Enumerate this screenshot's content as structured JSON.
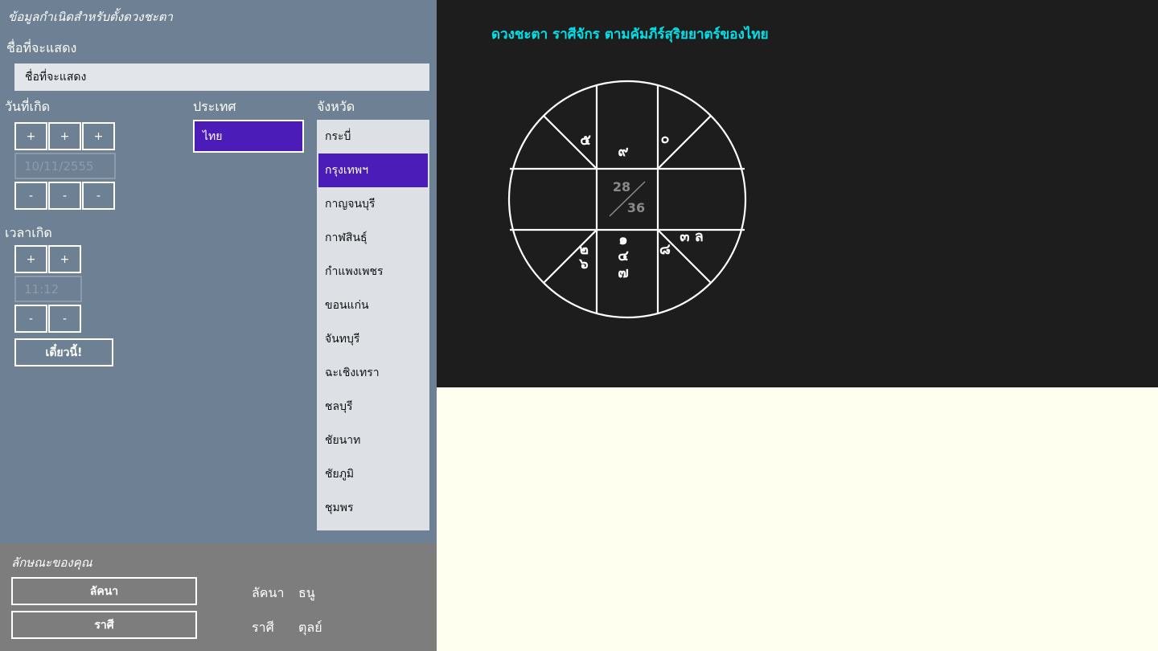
{
  "birth": {
    "header": "ข้อมูลกำเนิดสำหรับตั้งดวงชะตา",
    "name_label": "ชื่อที่จะแสดง",
    "name_value": "ชื่อที่จะแสดง",
    "date_label": "วันที่เกิด",
    "date_value": "10/11/2555",
    "plus": "+",
    "minus": "-",
    "time_label": "เวลาเกิด",
    "time_value": "11:12",
    "now_button": "เดี๋ยวนี้!",
    "country_label": "ประเทศ",
    "countries": [
      "ไทย"
    ],
    "province_label": "จังหวัด",
    "provinces": [
      "กระบี่",
      "กรุงเทพฯ",
      "กาญจนบุรี",
      "กาฬสินธุ์",
      "กำแพงเพชร",
      "ขอนแก่น",
      "จันทบุรี",
      "ฉะเชิงเทรา",
      "ชลบุรี",
      "ชัยนาท",
      "ชัยภูมิ",
      "ชุมพร"
    ],
    "selected_province": "กรุงเทพฯ"
  },
  "traits": {
    "header": "ลักษณะของคุณ",
    "lagna_button": "ลัคนา",
    "rasi_button": "ราศี",
    "lagna_label": "ลัคนา",
    "lagna_value": "ธนู",
    "rasi_label": "ราศี",
    "rasi_value": "ตุลย์"
  },
  "chart": {
    "title": "ดวงชะตา ราศีจักร ตามคัมภีร์สุริยยาตร์ของไทย",
    "title_color": "#00e0e8",
    "center_top": "28",
    "center_bottom": "36",
    "cells": {
      "upper_left_diag": "๕",
      "top_middle": "๙",
      "upper_right_diag": "๐",
      "bottom_left_diag": [
        "๒",
        "๖"
      ],
      "bottom_middle": [
        "๑",
        "๔",
        "๗"
      ],
      "bottom_right_top": "๓ ล",
      "bottom_right_diag": "๘"
    }
  },
  "colors": {
    "left_panel": "#6e8194",
    "bottom_panel": "#7d7d7d",
    "chart_bg": "#1d1d1d",
    "lower_bg": "#fffff0",
    "selected": "#4b1cb8"
  }
}
